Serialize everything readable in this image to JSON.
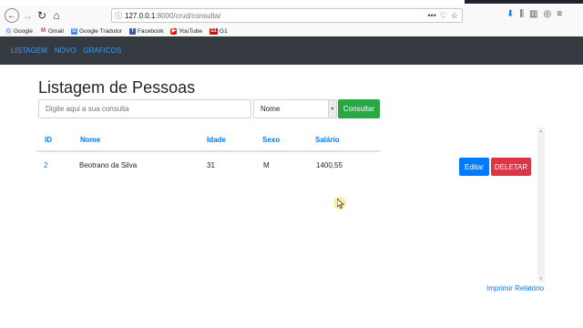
{
  "browser": {
    "url_host": "127.0.0.1",
    "url_path": ":8000/crud/consulta/",
    "url_actions": [
      "•••",
      "♡",
      "☆"
    ],
    "bookmarks": [
      {
        "label": "Google",
        "icon": "G"
      },
      {
        "label": "Gmail",
        "icon": "M"
      },
      {
        "label": "Google Tradutor",
        "icon": "G"
      },
      {
        "label": "Facebook",
        "icon": "f"
      },
      {
        "label": "YouTube",
        "icon": "▶"
      },
      {
        "label": "G1",
        "icon": "G1"
      }
    ]
  },
  "navbar": {
    "items": [
      "LISTAGEM",
      "NOVO",
      "GRAFICOS"
    ]
  },
  "main": {
    "title": "Listagem de Pessoas",
    "search_placeholder": "Digite aqui a sua consulta",
    "select_value": "Nome",
    "consultar_label": "Consultar",
    "table": {
      "headers": [
        "ID",
        "Nome",
        "Idade",
        "Sexo",
        "Salário"
      ],
      "rows": [
        {
          "id": "2",
          "nome": "Beotrano da Silva",
          "idade": "31",
          "sexo": "M",
          "salario": "1400,55"
        }
      ],
      "edit_label": "Editar",
      "delete_label": "DELETAR"
    },
    "print_label": "Imprimir Relatório"
  },
  "colors": {
    "navbar": "#343a40",
    "link": "#007bff",
    "success": "#28a745",
    "danger": "#dc3545"
  }
}
